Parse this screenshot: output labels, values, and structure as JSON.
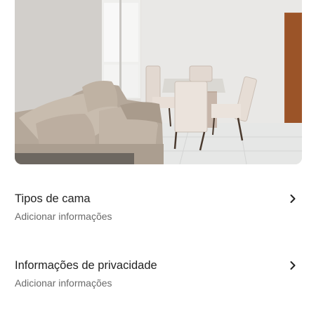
{
  "listing_photo": {
    "icon": "room-photo"
  },
  "rows": [
    {
      "title": "Tipos de cama",
      "subtitle": "Adicionar informações",
      "icon": "chevron-right-icon"
    },
    {
      "title": "Informações de privacidade",
      "subtitle": "Adicionar informações",
      "icon": "chevron-right-icon"
    }
  ],
  "colors": {
    "text": "#222222",
    "subtext": "#6a6a6a",
    "background": "#ffffff"
  }
}
